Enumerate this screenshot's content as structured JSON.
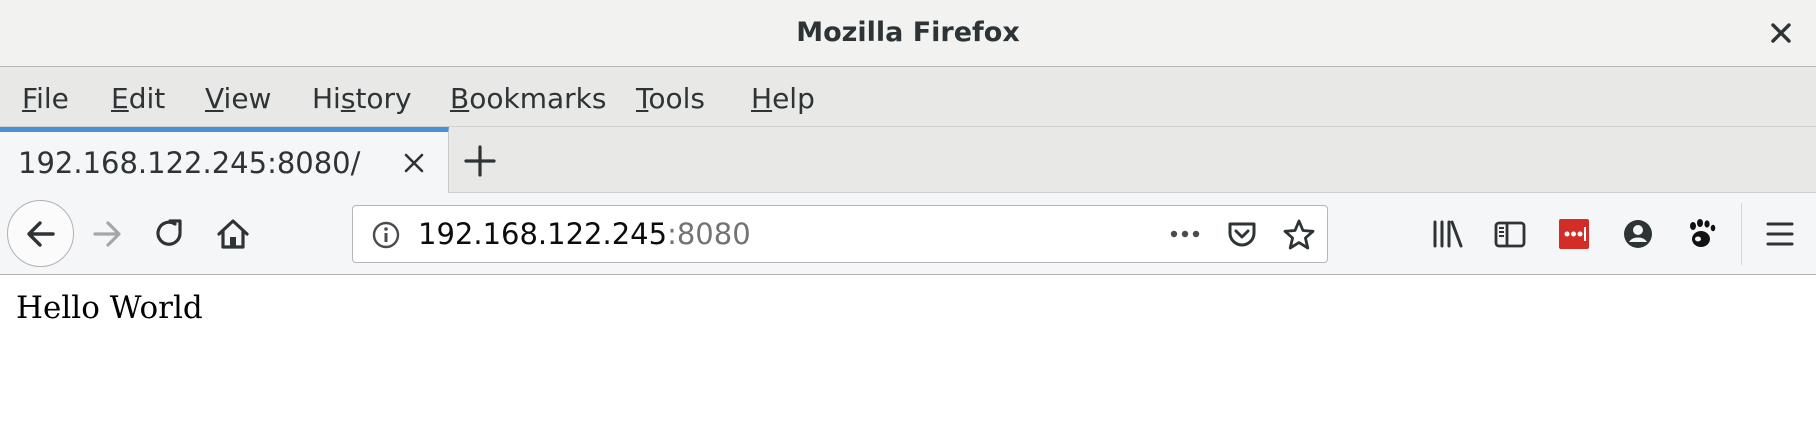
{
  "window": {
    "title": "Mozilla Firefox"
  },
  "menu": {
    "items": [
      {
        "label": "File",
        "mnemonic": "F"
      },
      {
        "label": "Edit",
        "mnemonic": "E"
      },
      {
        "label": "View",
        "mnemonic": "V"
      },
      {
        "label": "History",
        "mnemonic": "s"
      },
      {
        "label": "Bookmarks",
        "mnemonic": "B"
      },
      {
        "label": "Tools",
        "mnemonic": "T"
      },
      {
        "label": "Help",
        "mnemonic": "H"
      }
    ]
  },
  "tabs": [
    {
      "title": "192.168.122.245:8080/",
      "active": true
    }
  ],
  "urlbar": {
    "host": "192.168.122.245",
    "port": ":8080"
  },
  "toolbar": {
    "icons": [
      "library-icon",
      "sidebar-icon",
      "lastpass-icon",
      "account-icon",
      "gnome-extension-icon",
      "hamburger-menu-icon"
    ]
  },
  "content": {
    "text": "Hello World"
  },
  "colors": {
    "tab_accent": "#4a90d9",
    "lastpass_red": "#d32d27",
    "disabled_forward": "#a7a7a9"
  }
}
